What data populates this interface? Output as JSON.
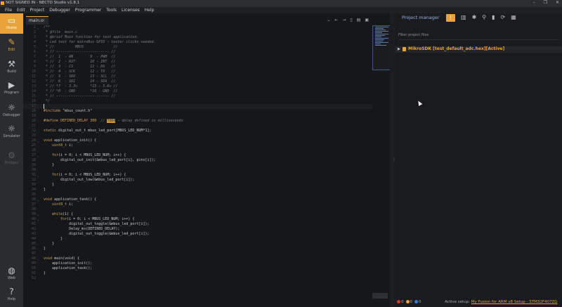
{
  "window": {
    "title": "NOT SIGNED IN - NECTO Studio v1.8.1",
    "controls": [
      "–",
      "❐",
      "✕"
    ]
  },
  "menu": [
    "File",
    "Edit",
    "Project",
    "Debugger",
    "Programmer",
    "Tools",
    "Licenses",
    "Help"
  ],
  "sidebar": {
    "items": [
      {
        "label": "Home",
        "icon": "▭",
        "state": "active"
      },
      {
        "label": "Edit",
        "icon": "✎",
        "state": "selected"
      },
      {
        "label": "Build",
        "icon": "⚒",
        "state": "normal"
      },
      {
        "label": "Program",
        "icon": "▶",
        "state": "normal"
      },
      {
        "label": "Debugger",
        "icon": "☼",
        "state": "normal"
      },
      {
        "label": "Simulator",
        "icon": "☼",
        "state": "normal"
      },
      {
        "label": "Bridges",
        "icon": "⚙",
        "state": "disabled"
      }
    ],
    "bottom": [
      {
        "label": "Web",
        "icon": "◍"
      },
      {
        "label": "Help",
        "icon": "?"
      }
    ]
  },
  "editor": {
    "tab": {
      "label": "main.c",
      "close": "×"
    },
    "tools": [
      "⌄",
      "←",
      "→",
      "▯",
      "▤",
      "▣"
    ],
    "lines": [
      {
        "n": "1",
        "f": "⌄",
        "t": "/**",
        "c": "com"
      },
      {
        "n": "2",
        "f": "",
        "t": " * @file  main.c",
        "c": "com"
      },
      {
        "n": "3",
        "f": "",
        "t": " * @brief Main function for test application.",
        "c": "com"
      },
      {
        "n": "4",
        "f": "",
        "t": " * Led test for mikroBus GPIO - tester clicks needed.",
        "c": "com"
      },
      {
        "n": "5",
        "f": "",
        "t": " * //          MBUS              //",
        "c": "com"
      },
      {
        "n": "6",
        "f": "",
        "t": " * // ------------------------- //",
        "c": "com"
      },
      {
        "n": "7",
        "f": "",
        "t": " * //  1  - AN        9  - PWM  //",
        "c": "com"
      },
      {
        "n": "8",
        "f": "",
        "t": " * //  2  - RST       10 - INT  //",
        "c": "com"
      },
      {
        "n": "9",
        "f": "",
        "t": " * //  3  - CS        11 - RX   //",
        "c": "com"
      },
      {
        "n": "10",
        "f": "",
        "t": " * //  4  - SCK       12 - TX   //",
        "c": "com"
      },
      {
        "n": "11",
        "f": "",
        "t": " * //  5  - SDO       13 - SCL  //",
        "c": "com"
      },
      {
        "n": "12",
        "f": "",
        "t": " * //  6  - SDI       14 - SDA  //",
        "c": "com"
      },
      {
        "n": "13",
        "f": "",
        "t": " * // *7  - 3.3v      *15 - 5.0v //",
        "c": "com"
      },
      {
        "n": "14",
        "f": "",
        "t": " * // *8  - GND       *16 - GND  //",
        "c": "com"
      },
      {
        "n": "15",
        "f": "",
        "t": " * // ------------------------- //",
        "c": "com"
      },
      {
        "n": "16",
        "f": "",
        "t": " */",
        "c": "com"
      },
      {
        "n": "17",
        "f": "",
        "t": "",
        "c": "cur"
      },
      {
        "n": "18",
        "f": "",
        "t": "#include \"mbus_count.h\"",
        "c": "pre"
      },
      {
        "n": "19",
        "f": "",
        "t": "",
        "c": ""
      },
      {
        "n": "20",
        "f": "",
        "t": "#define DEFINED_DELAY 300",
        "c": "define"
      },
      {
        "n": "21",
        "f": "",
        "t": "",
        "c": ""
      },
      {
        "n": "22",
        "f": "",
        "t": "static digital_out_t mbus_led_port[MBUS_LED_NUM*1];",
        "c": ""
      },
      {
        "n": "23",
        "f": "",
        "t": "",
        "c": ""
      },
      {
        "n": "24",
        "f": "⌄",
        "t": "void application_init() {",
        "c": ""
      },
      {
        "n": "25",
        "f": "",
        "t": "    uint8_t i;",
        "c": ""
      },
      {
        "n": "26",
        "f": "",
        "t": "",
        "c": ""
      },
      {
        "n": "27",
        "f": "⌄",
        "t": "    for(i = 0; i < MBUS_LED_NUM; i++) {",
        "c": ""
      },
      {
        "n": "28",
        "f": "",
        "t": "        digital_out_init(&mbus_led_port[i], pins[i]);",
        "c": ""
      },
      {
        "n": "29",
        "f": "",
        "t": "    }",
        "c": ""
      },
      {
        "n": "30",
        "f": "",
        "t": "",
        "c": ""
      },
      {
        "n": "31",
        "f": "⌄",
        "t": "    for(i = 0; i < MBUS_LED_NUM; i++) {",
        "c": ""
      },
      {
        "n": "32",
        "f": "",
        "t": "        digital_out_low(&mbus_led_port[i]);",
        "c": ""
      },
      {
        "n": "33",
        "f": "",
        "t": "    }",
        "c": ""
      },
      {
        "n": "34",
        "f": "",
        "t": "}",
        "c": ""
      },
      {
        "n": "35",
        "f": "",
        "t": "",
        "c": ""
      },
      {
        "n": "36",
        "f": "⌄",
        "t": "void application_task() {",
        "c": ""
      },
      {
        "n": "37",
        "f": "",
        "t": "    uint8_t i;",
        "c": ""
      },
      {
        "n": "38",
        "f": "",
        "t": "",
        "c": ""
      },
      {
        "n": "39",
        "f": "⌄",
        "t": "    while(1) {",
        "c": ""
      },
      {
        "n": "40",
        "f": "⌄",
        "t": "        for(i = 0; i < MBUS_LED_NUM; i++) {",
        "c": ""
      },
      {
        "n": "41",
        "f": "",
        "t": "            digital_out_toggle(&mbus_led_port[i]);",
        "c": ""
      },
      {
        "n": "42",
        "f": "",
        "t": "            Delay_ms(DEFINED_DELAY);",
        "c": ""
      },
      {
        "n": "43",
        "f": "",
        "t": "            digital_out_toggle(&mbus_led_port[i]);",
        "c": ""
      },
      {
        "n": "44",
        "f": "",
        "t": "        }",
        "c": ""
      },
      {
        "n": "45",
        "f": "",
        "t": "    }",
        "c": ""
      },
      {
        "n": "46",
        "f": "",
        "t": "}",
        "c": ""
      },
      {
        "n": "47",
        "f": "",
        "t": "",
        "c": ""
      },
      {
        "n": "48",
        "f": "⌄",
        "t": "void main(void) {",
        "c": ""
      },
      {
        "n": "49",
        "f": "",
        "t": "    application_init();",
        "c": ""
      },
      {
        "n": "50",
        "f": "",
        "t": "    application_task();",
        "c": ""
      },
      {
        "n": "51",
        "f": "",
        "t": "}",
        "c": ""
      },
      {
        "n": "52",
        "f": "",
        "t": "",
        "c": ""
      }
    ],
    "define_todo": "TODO",
    "define_comment_pre": "// ",
    "define_comment_post": " - delay defined in milliseconds"
  },
  "project_manager": {
    "title": "Project manager",
    "icons": [
      "!",
      "▥",
      "✱",
      "⚲",
      "▮",
      "⟳",
      "▦"
    ],
    "filter_placeholder": "Filter project files",
    "tree_item": "MikroSDK [test_default_adc.hex][Active]"
  },
  "status": {
    "errors": "0",
    "warnings": "0",
    "infos": "0",
    "setup_label": "Active setup:",
    "setup_value": "My Fusion for ARM v8 Setup - STM32F407ZG",
    "colors": {
      "error": "#d9362b",
      "warning": "#e8a33a",
      "info": "#3a7bd5"
    }
  }
}
